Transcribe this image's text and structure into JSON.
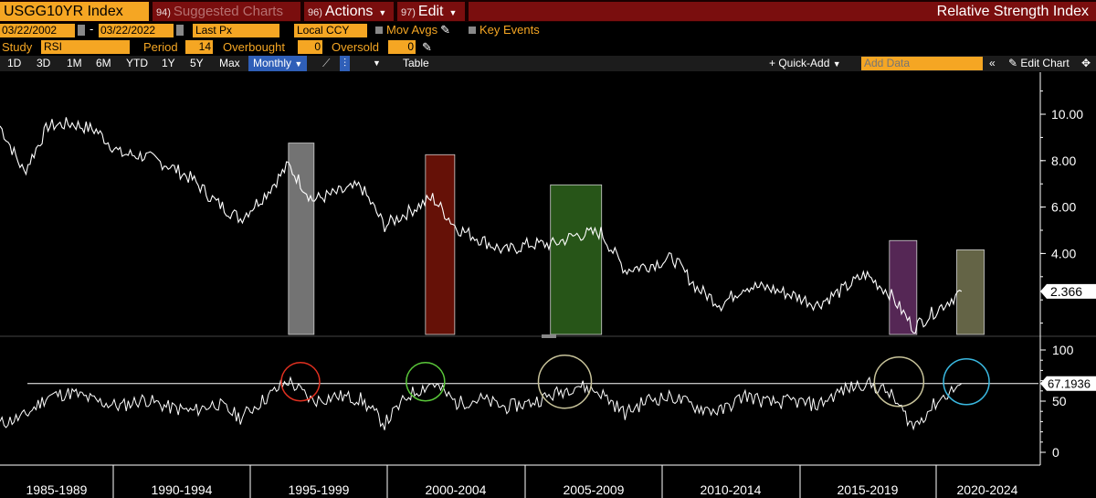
{
  "header": {
    "ticker": "USGG10YR Index",
    "suggested": {
      "num": "94)",
      "label": "Suggested Charts"
    },
    "actions": {
      "num": "96)",
      "label": "Actions"
    },
    "edit": {
      "num": "97)",
      "label": "Edit"
    },
    "title": "Relative Strength Index"
  },
  "range": {
    "start": "03/22/2002",
    "sep": "-",
    "end": "03/22/2022",
    "price_field": "Last Px",
    "currency": "Local CCY",
    "mov_avgs": "Mov Avgs",
    "key_events": "Key Events"
  },
  "study": {
    "label": "Study",
    "value": "RSI",
    "period_label": "Period",
    "period": "14",
    "overbought_label": "Overbought",
    "overbought": "0",
    "oversold_label": "Oversold",
    "oversold": "0"
  },
  "toolbar": {
    "periods": [
      "1D",
      "3D",
      "1M",
      "6M",
      "YTD",
      "1Y",
      "5Y",
      "Max"
    ],
    "frequency": "Monthly",
    "table": "Table",
    "quick_add": "Quick-Add",
    "add_data_placeholder": "Add Data",
    "edit_chart": "Edit Chart"
  },
  "colors": {
    "accent": "#f5a623",
    "header_red": "#7a0e0e",
    "active_blue": "#2f5fb8"
  },
  "chart_data": [
    {
      "type": "line",
      "series": [
        {
          "x": [
            1982,
            1983,
            1984,
            1985,
            1986,
            1987,
            1988,
            1989,
            1990,
            1991,
            1992,
            1993,
            1994,
            1995,
            1996,
            1997,
            1998,
            1999,
            2000,
            2001,
            2002,
            2003,
            2004,
            2005,
            2006,
            2007,
            2008,
            2009,
            2010,
            2011,
            2012,
            2013,
            2014,
            2015,
            2016,
            2017,
            2018,
            2019,
            2020,
            2021,
            2022
          ],
          "values": [
            9.5,
            7.5,
            9.5,
            9.6,
            9.3,
            8.3,
            8.2,
            7.8,
            7.2,
            6.2,
            5.5,
            6.5,
            7.8,
            6.3,
            6.6,
            6.9,
            5.2,
            5.8,
            6.4,
            5.1,
            4.6,
            4.1,
            4.4,
            4.4,
            4.8,
            4.9,
            3.3,
            3.5,
            3.8,
            2.5,
            1.8,
            2.6,
            2.5,
            2.2,
            1.8,
            2.4,
            3.1,
            2.3,
            0.8,
            1.6,
            2.366
          ]
        }
      ],
      "yticks": [
        "10.00",
        "8.00",
        "6.00",
        "4.00"
      ],
      "last_value": "2.366",
      "highlight_colors": [
        "#7a7a7a",
        "#6b1208",
        "#2a5a1a",
        "#5a2a5a",
        "#6a6a4a"
      ]
    },
    {
      "type": "line",
      "series": [
        {
          "x": [
            1982,
            1983,
            1984,
            1985,
            1986,
            1987,
            1988,
            1989,
            1990,
            1991,
            1992,
            1993,
            1994,
            1995,
            1996,
            1997,
            1998,
            1999,
            2000,
            2001,
            2002,
            2003,
            2004,
            2005,
            2006,
            2007,
            2008,
            2009,
            2010,
            2011,
            2012,
            2013,
            2014,
            2015,
            2016,
            2017,
            2018,
            2019,
            2020,
            2021,
            2022
          ],
          "values": [
            28,
            35,
            55,
            58,
            50,
            45,
            52,
            44,
            40,
            48,
            34,
            52,
            70,
            50,
            55,
            52,
            28,
            56,
            68,
            48,
            52,
            44,
            48,
            56,
            66,
            58,
            38,
            52,
            54,
            44,
            40,
            56,
            48,
            50,
            46,
            60,
            68,
            58,
            25,
            50,
            67.19
          ]
        }
      ],
      "yticks": [
        "100",
        "50",
        "0"
      ],
      "level_value": "67.1936",
      "circle_colors": [
        "#e03020",
        "#5ac83a",
        "#c8c39a",
        "#c8c39a",
        "#3ab8e0"
      ]
    }
  ],
  "periods_axis": [
    "1985-1989",
    "1990-1994",
    "1995-1999",
    "2000-2004",
    "2005-2009",
    "2010-2014",
    "2015-2019",
    "2020-2024"
  ]
}
